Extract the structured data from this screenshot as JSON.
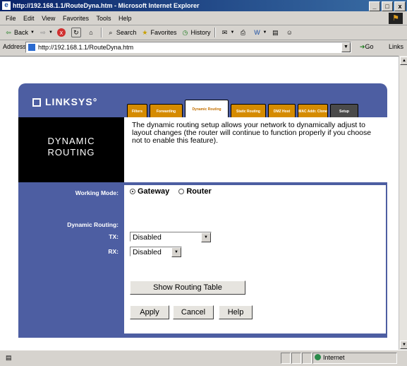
{
  "window": {
    "title": "http://192.168.1.1/RouteDyna.htm - Microsoft Internet Explorer",
    "controls": [
      "_",
      "□",
      "x"
    ]
  },
  "menu": [
    "File",
    "Edit",
    "View",
    "Favorites",
    "Tools",
    "Help"
  ],
  "toolbar": {
    "back": "Back",
    "search": "Search",
    "favorites": "Favorites",
    "history": "History"
  },
  "address": {
    "label": "Address",
    "url": "http://192.168.1.1/RouteDyna.htm",
    "go": "Go",
    "links": "Links"
  },
  "page": {
    "logo": "LINKSYS",
    "tabs": [
      {
        "label": "Filters"
      },
      {
        "label": "Forwarding"
      },
      {
        "label": "Dynamic Routing"
      },
      {
        "label": "Static Routing"
      },
      {
        "label": "DMZ Host"
      },
      {
        "label": "MAC Addr. Clone"
      },
      {
        "label": "Setup"
      }
    ],
    "section_title_line1": "DYNAMIC",
    "section_title_line2": "ROUTING",
    "description": "The dynamic routing setup allows your network to dynamically adjust to layout changes (the router will continue to function properly if you choose not to enable this feature).",
    "working_mode_label": "Working Mode:",
    "mode_gateway": "Gateway",
    "mode_router": "Router",
    "dynamic_routing_label": "Dynamic Routing:",
    "tx_label": "TX:",
    "tx_value": "Disabled",
    "rx_label": "RX:",
    "rx_value": "Disabled",
    "show_table_button": "Show Routing Table",
    "apply_button": "Apply",
    "cancel_button": "Cancel",
    "help_button": "Help"
  },
  "status": {
    "zone": "Internet"
  }
}
